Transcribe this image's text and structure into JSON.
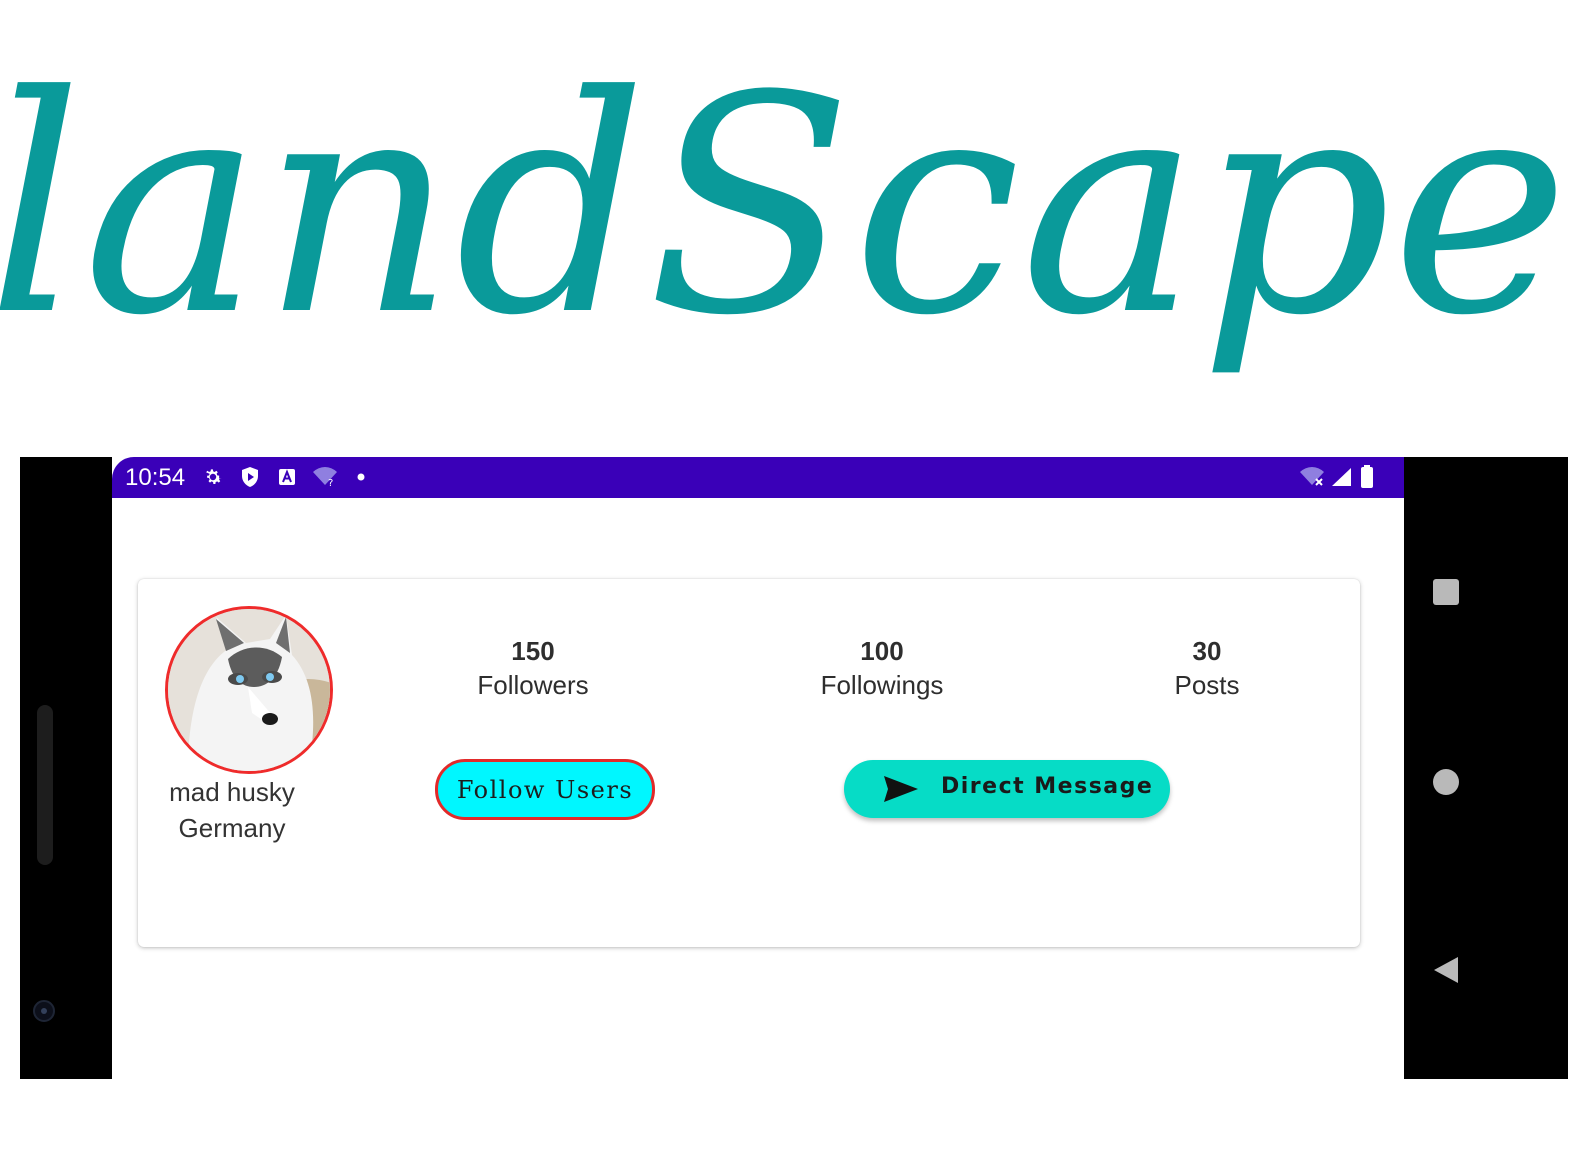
{
  "hero": {
    "title": "landScape",
    "color": "#0a9a9a"
  },
  "status_bar": {
    "time": "10:54",
    "background": "#3a00b8",
    "icons_left": [
      "gear-icon",
      "shield-icon",
      "a-badge-icon",
      "wifi-question-icon",
      "dot-icon"
    ],
    "icons_right": [
      "wifi-off-icon",
      "signal-icon",
      "battery-icon"
    ]
  },
  "profile": {
    "name": "mad husky",
    "location": "Germany",
    "avatar_border": "#ef2b2b",
    "stats": [
      {
        "value": "150",
        "label": "Followers"
      },
      {
        "value": "100",
        "label": "Followings"
      },
      {
        "value": "30",
        "label": "Posts"
      }
    ]
  },
  "actions": {
    "follow_label": "Follow Users",
    "follow_color": "#00f7ff",
    "dm_label": "Direct Message",
    "dm_color": "#06dcc6",
    "dm_icon": "send-icon"
  },
  "nav": {
    "recents_icon": "square-icon",
    "home_icon": "circle-icon",
    "back_icon": "triangle-back-icon"
  }
}
